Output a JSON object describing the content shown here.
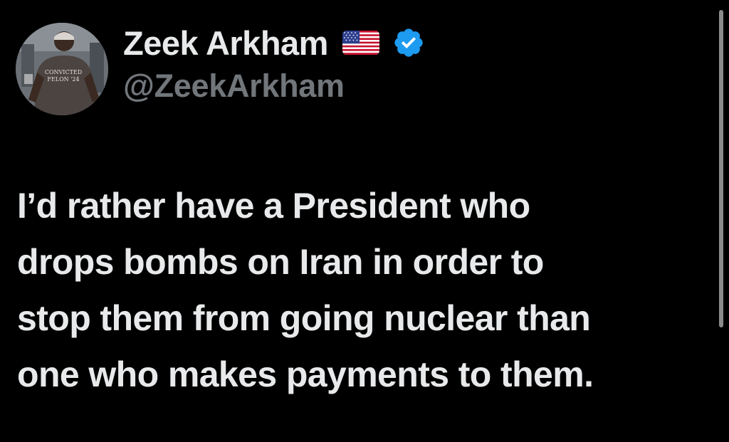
{
  "author": {
    "display_name": "Zeek Arkham",
    "handle": "@ZeekArkham",
    "flag_icon": "us-flag-emoji",
    "verified_icon": "verified-badge-icon",
    "verified_color": "#1d9bf0",
    "avatar_shirt_text": "CONVICTED FELON 24"
  },
  "tweet": {
    "lines": [
      "I’d rather have a President who",
      "drops bombs on Iran in order to",
      "stop them from going nuclear than",
      "one who makes payments to them."
    ]
  },
  "colors": {
    "background": "#000000",
    "text": "#e7e9ea",
    "secondary_text": "#71767b"
  }
}
